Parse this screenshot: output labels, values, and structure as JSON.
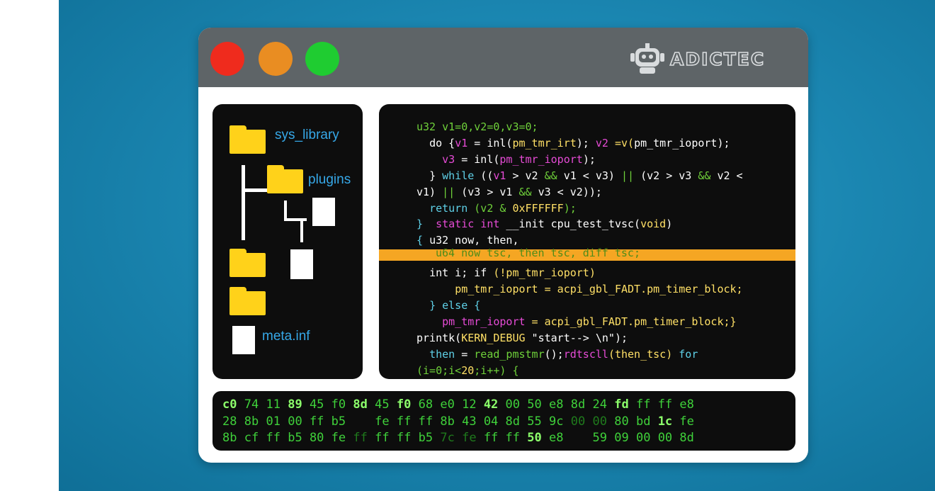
{
  "brand": {
    "name": "ADICTEC",
    "logo_icon": "robot-icon"
  },
  "colors": {
    "close": "#ef2b1d",
    "minimize": "#e98d22",
    "maximize": "#1fcc31",
    "highlight": "#f5a623"
  },
  "file_tree": {
    "sys_library": "sys_library",
    "plugins": "plugins",
    "meta": "meta.inf"
  },
  "code": {
    "l1": "u32 v1=0,v2=0,v3=0;",
    "l2a": "do {",
    "l2b": "v1",
    "l2c": " = inl(",
    "l2d": "pm_tmr_irt",
    "l2e": "); ",
    "l2f": "v2",
    "l2g": " =v(",
    "l2h": "pm_tmr_ioport",
    "l2i": ");",
    "l3a": "v3",
    "l3b": " = inl(",
    "l3c": "pm_tmr_ioport",
    "l3d": ");",
    "l4a": "} ",
    "l4b": "while",
    "l4c": " ((",
    "l4d": "v1",
    "l4e": " > v2 ",
    "l4f": "&&",
    "l4g": " v1 < v3) ",
    "l4h": "||",
    "l4i": " (v2 > v3 ",
    "l4j": "&&",
    "l4k": " v2 <",
    "l5a": "v1) ",
    "l5b": "||",
    "l5c": " (v3 > v1 ",
    "l5d": "&&",
    "l5e": " v3 < v2));",
    "l6a": "return",
    "l6b": " (v2 & ",
    "l6c": "0xFFFFFF",
    "l6d": ");",
    "l7a": "}  ",
    "l7b": "static int",
    "l7c": " __init cpu_test_tvsc(",
    "l7d": "void",
    "l7e": ")",
    "l8a": "{ ",
    "l8b": "u32 now, then,",
    "l9": "u64 now tsc, then tsc, diff tsc;",
    "l10a": "int i; ",
    "l10b": "if",
    "l10c": " (!pm_tmr_ioport)",
    "l11": "pm_tmr_ioport = acpi_gbl_FADT.pm_timer_block;",
    "l12": "} else {",
    "l13a": "pm_tmr_ioport",
    "l13b": " = acpi_gbl_FADT.pm_timer_block;}",
    "l14a": "printk(",
    "l14b": "KERN_DEBUG",
    "l14c": " \"start--> \\n\");",
    "l15a": "then",
    "l15b": " = ",
    "l15c": "read_pmstmr",
    "l15d": "();",
    "l15e": "rdtscll",
    "l15f": "(then_tsc) ",
    "l15g": "for",
    "l16a": "(i=0;i<",
    "l16b": "20",
    "l16c": ";i++) {"
  },
  "hex": {
    "r1": [
      [
        "c0",
        "b"
      ],
      [
        "74",
        "n"
      ],
      [
        "11",
        "n"
      ],
      [
        "89",
        "b"
      ],
      [
        "45",
        "n"
      ],
      [
        "f0",
        "n"
      ],
      [
        "8d",
        "b"
      ],
      [
        "45",
        "n"
      ],
      [
        "f0",
        "b"
      ],
      [
        "68",
        "n"
      ],
      [
        "e0",
        "n"
      ],
      [
        "12",
        "n"
      ],
      [
        "42",
        "b"
      ],
      [
        "00",
        "n"
      ],
      [
        "50",
        "n"
      ],
      [
        "e8",
        "n"
      ],
      [
        "8d",
        "n"
      ],
      [
        "24",
        "n"
      ],
      [
        "fd",
        "b"
      ],
      [
        "ff",
        "n"
      ],
      [
        "ff",
        "n"
      ],
      [
        "e8",
        "n"
      ]
    ],
    "r2": [
      [
        "28",
        "n"
      ],
      [
        "8b",
        "n"
      ],
      [
        "01",
        "n"
      ],
      [
        "00",
        "n"
      ],
      [
        "ff",
        "n"
      ],
      [
        "b5",
        "n"
      ],
      [
        "  ",
        "n"
      ],
      [
        "fe",
        "n"
      ],
      [
        "ff",
        "n"
      ],
      [
        "ff",
        "n"
      ],
      [
        "8b",
        "n"
      ],
      [
        "43",
        "n"
      ],
      [
        "04",
        "n"
      ],
      [
        "8d",
        "n"
      ],
      [
        "55",
        "n"
      ],
      [
        "9c",
        "n"
      ],
      [
        "00",
        "d"
      ],
      [
        "00",
        "d"
      ],
      [
        "80",
        "n"
      ],
      [
        "bd",
        "n"
      ],
      [
        "1c",
        "b"
      ],
      [
        "fe",
        "n"
      ]
    ],
    "r3": [
      [
        "8b",
        "n"
      ],
      [
        "cf",
        "n"
      ],
      [
        "ff",
        "n"
      ],
      [
        "b5",
        "n"
      ],
      [
        "80",
        "n"
      ],
      [
        "fe",
        "n"
      ],
      [
        "ff",
        "d"
      ],
      [
        "ff",
        "n"
      ],
      [
        "ff",
        "n"
      ],
      [
        "b5",
        "n"
      ],
      [
        "7c",
        "d"
      ],
      [
        "fe",
        "d"
      ],
      [
        "ff",
        "n"
      ],
      [
        "ff",
        "n"
      ],
      [
        "50",
        "b"
      ],
      [
        "e8",
        "n"
      ],
      [
        "  ",
        "n"
      ],
      [
        "59",
        "n"
      ],
      [
        "09",
        "n"
      ],
      [
        "00",
        "n"
      ],
      [
        "00",
        "n"
      ],
      [
        "8d",
        "n"
      ]
    ]
  }
}
